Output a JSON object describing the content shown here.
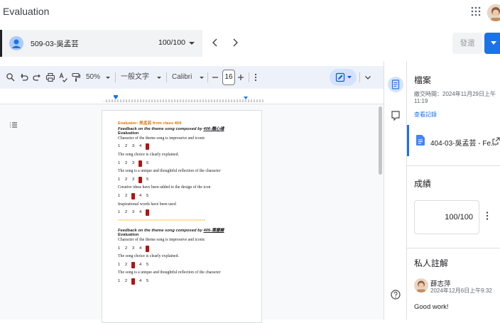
{
  "header": {
    "title": "Evaluation"
  },
  "student_bar": {
    "student_name": "509-03-吳孟芸",
    "score": "100/100",
    "return_label": "發還"
  },
  "toolbar": {
    "zoom": "50%",
    "style": "一般文字",
    "font": "Calibri",
    "font_size": "16"
  },
  "document": {
    "evaluator": "Evaluator: 吳孟芸 from class 404",
    "feedback1_prefix": "Feedback on the theme song composed by ",
    "feedback1_group": "406-醜心魂",
    "feedback2_prefix": "Feedback on the theme song composed by ",
    "feedback2_group": "405-葉曆雞",
    "evaluation_label": "Evaluation",
    "criteria": [
      "Character of the theme song is impressive and iconic",
      "The song choice is clearly explained.",
      "The song is a unique and thoughtful reflection of the character",
      "Creative ideas have been added to the design of the icon",
      "Inspirational words have been used"
    ],
    "scale": [
      "1",
      "2",
      "3",
      "4",
      "5"
    ],
    "group1_selected": [
      5,
      4,
      4,
      3,
      5
    ],
    "group2_selected": [
      5,
      3,
      3
    ],
    "stars": "**************************************************",
    "highlight_color": "#b31412"
  },
  "side_panel": {
    "files_title": "檔案",
    "submitted_label": "繳交時間：2024年11月29日上午",
    "submitted_time": "11:19",
    "history_link": "查看記錄",
    "file_name": "404-03-吳孟芸 - Fe...",
    "grade_title": "成績",
    "grade_value": "100/100",
    "notes_title": "私人註解",
    "comment_author": "薛志萍",
    "comment_time": "2024年12月6日上午9:32",
    "comment_text": "Good work!"
  },
  "colors": {
    "accent": "#1a73e8",
    "toolbar_bg": "#edf2fa"
  }
}
